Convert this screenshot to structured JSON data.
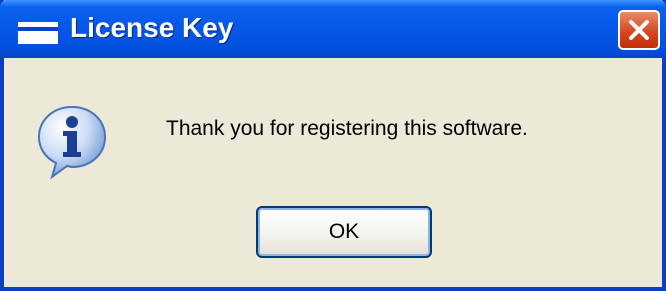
{
  "dialog": {
    "title": "License Key",
    "message": "Thank you for registering this software.",
    "ok_label": "OK",
    "icon": "information-icon"
  },
  "titlebar": {
    "window_icon": "window-icon",
    "close_icon": "close-icon"
  },
  "colors": {
    "titlebar": "#0656e8",
    "frame": "#0a3fc6",
    "dialog_background": "#ece9d8",
    "close_button": "#d5411b",
    "button_border": "#003c74"
  }
}
